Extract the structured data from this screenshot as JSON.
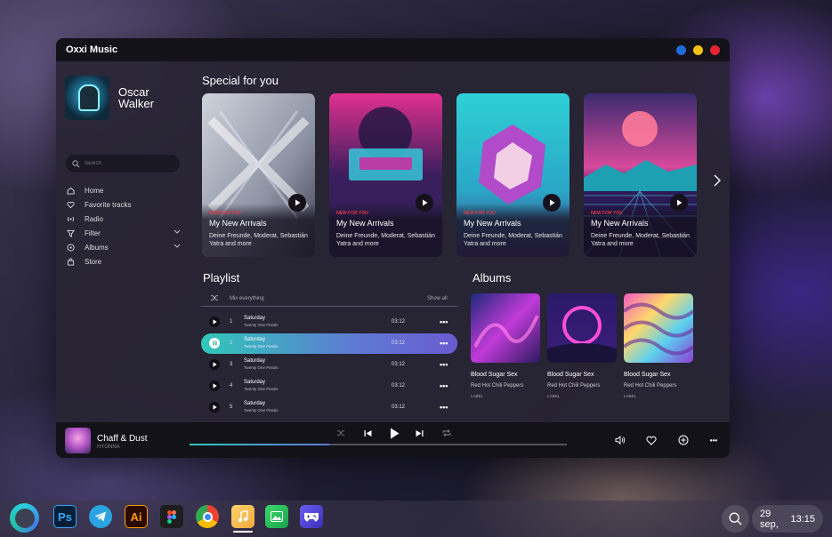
{
  "window": {
    "title": "Oxxi Music",
    "traffic_lights": [
      "#1e6bdc",
      "#f2c20f",
      "#e52233"
    ]
  },
  "sidebar": {
    "profile": {
      "name": "Oscar Walker"
    },
    "search": {
      "placeholder": "Search"
    },
    "items": [
      {
        "label": "Home",
        "icon": "home-icon"
      },
      {
        "label": "Favorite tracks",
        "icon": "heart-icon"
      },
      {
        "label": "Radio",
        "icon": "radio-icon"
      },
      {
        "label": "Filter",
        "icon": "filter-icon",
        "expandable": true
      },
      {
        "label": "Albums",
        "icon": "album-icon",
        "expandable": true
      },
      {
        "label": "Store",
        "icon": "bag-icon"
      }
    ]
  },
  "special": {
    "heading": "Special for you",
    "cards": [
      {
        "tag": "NEW FOR YOU",
        "title": "My New Arrivals",
        "subtitle": "Deine Freunde, Moderat, Sebastián Yatra and more"
      },
      {
        "tag": "NEW FOR YOU",
        "title": "My New Arrivals",
        "subtitle": "Deine Freunde, Moderat, Sebastián Yatra and more"
      },
      {
        "tag": "NEW FOR YOU",
        "title": "My New Arrivals",
        "subtitle": "Deine Freunde, Moderat, Sebastián Yatra and more"
      },
      {
        "tag": "NEW FOR YOU",
        "title": "My New Arrivals",
        "subtitle": "Deine Freunde, Moderat, Sebastián Yatra and more"
      }
    ]
  },
  "playlist": {
    "heading": "Playlist",
    "mix_label": "Mix everything",
    "show_all": "Show all",
    "tracks": [
      {
        "num": "1",
        "title": "Saturday",
        "artist": "Twenty One Pistols",
        "time": "03:12"
      },
      {
        "num": "2",
        "title": "Saturday",
        "artist": "Twenty One Pistols",
        "time": "03:12"
      },
      {
        "num": "3",
        "title": "Saturday",
        "artist": "Twenty One Pistols",
        "time": "03:12"
      },
      {
        "num": "4",
        "title": "Saturday",
        "artist": "Twenty One Pistols",
        "time": "03:12"
      },
      {
        "num": "5",
        "title": "Saturday",
        "artist": "Twenty One Pistols",
        "time": "03:12"
      }
    ],
    "active_index": 1
  },
  "albums": {
    "heading": "Albums",
    "items": [
      {
        "title": "Blood Sugar Sex",
        "artist": "Red Hot Chili Peppers",
        "label": "LABEL"
      },
      {
        "title": "Blood Sugar Sex",
        "artist": "Red Hot Chili Peppers",
        "label": "LABEL"
      },
      {
        "title": "Blood Sugar Sex",
        "artist": "Red Hot Chili Peppers",
        "label": "LABEL"
      }
    ]
  },
  "player": {
    "title": "Chaff & Dust",
    "artist": "HYONNA",
    "progress": 0.37
  },
  "taskbar": {
    "apps": [
      "Ps",
      "Telegram",
      "Ai",
      "Figma",
      "Chrome",
      "Music",
      "Gallery",
      "Games"
    ],
    "active_app": "Music",
    "date": "29 sep,",
    "time": "13:15"
  }
}
